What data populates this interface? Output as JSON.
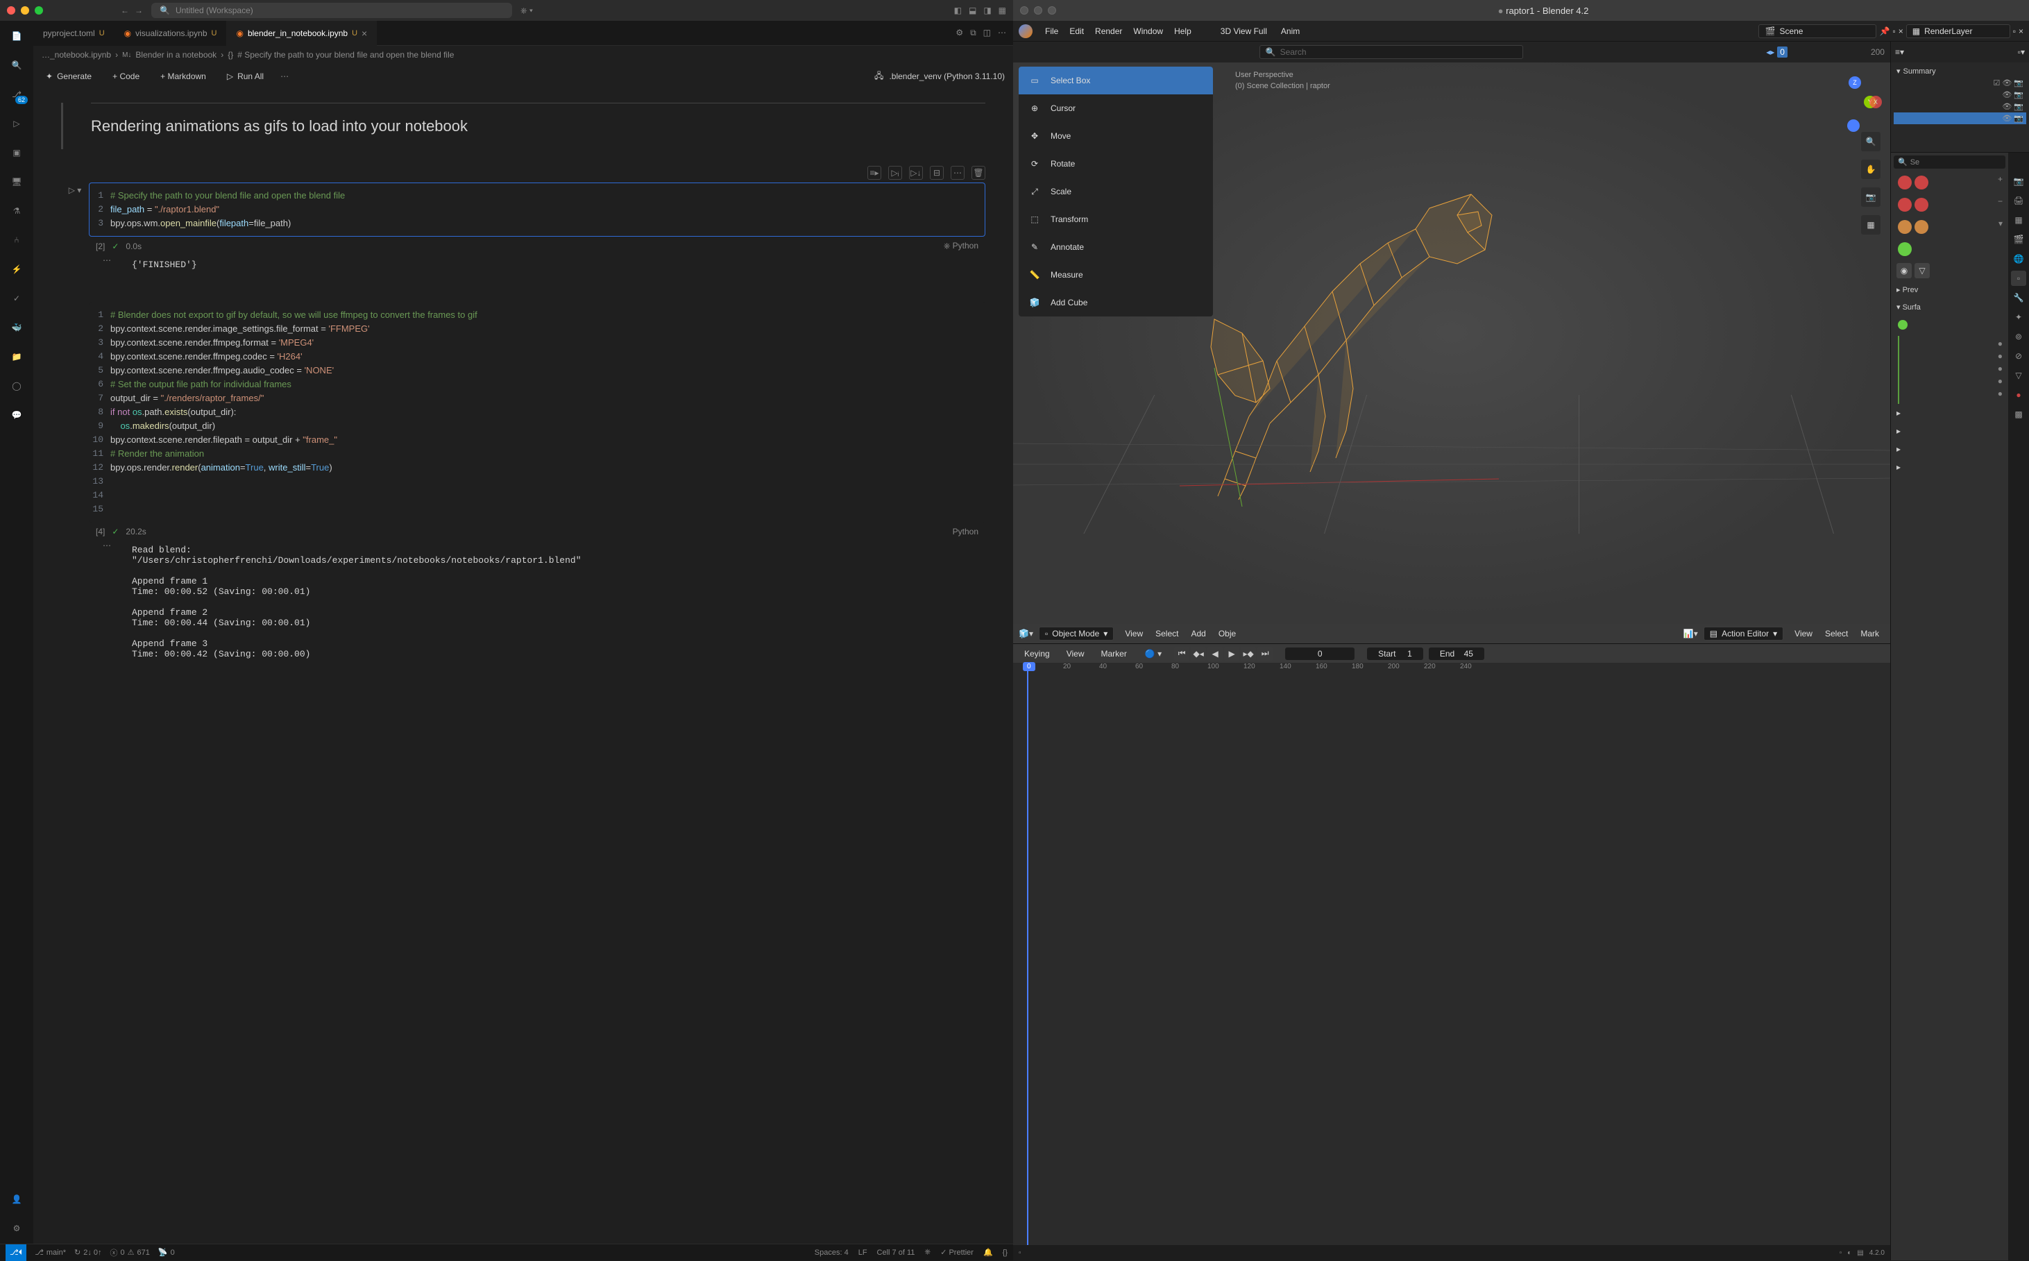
{
  "vscode": {
    "title": "Untitled (Workspace)",
    "traffic": {
      "red": "#ff5f56",
      "yellow": "#ffbd2e",
      "green": "#27c93f"
    },
    "activity_badge": "62",
    "tabs": [
      {
        "name": "pyproject.toml",
        "mod": "U"
      },
      {
        "name": "visualizations.ipynb",
        "mod": "U"
      },
      {
        "name": "blender_in_notebook.ipynb",
        "mod": "U",
        "active": true
      }
    ],
    "breadcrumb": {
      "file": "…_notebook.ipynb",
      "section_prefix": "M↓",
      "section": "Blender in a notebook",
      "cell": "# Specify the path to your blend file and open the blend file"
    },
    "toolbar": {
      "generate": "Generate",
      "code": "+ Code",
      "markdown": "+ Markdown",
      "run_all": "Run All",
      "kernel": ".blender_venv (Python 3.11.10)"
    },
    "md_heading": "Rendering animations as gifs to load into your notebook",
    "cell1": {
      "exec": "[2]",
      "time": "0.0s",
      "lang": "Python",
      "lines": {
        "l1_comment": "# Specify the path to your blend file and open the blend file",
        "l2_var": "file_path",
        "l2_eq": " = ",
        "l2_str": "\"./raptor1.blend\"",
        "l3_a": "bpy",
        "l3_b": ".ops.wm.",
        "l3_fn": "open_mainfile",
        "l3_c": "(",
        "l3_arg": "filepath",
        "l3_d": "=",
        "l3_arg2": "file_path",
        "l3_e": ")"
      },
      "output": "{'FINISHED'}"
    },
    "cell2": {
      "exec": "[4]",
      "time": "20.2s",
      "lang": "Python",
      "src": [
        {
          "n": "1",
          "html": "<span class='tok-comment'># Blender does not export to gif by default, so we will use ffmpeg to convert the frames to gif</span>"
        },
        {
          "n": "2",
          "html": "bpy.context.scene.render.image_settings.file_format = <span class='tok-str'>'FFMPEG'</span>"
        },
        {
          "n": "3",
          "html": "bpy.context.scene.render.ffmpeg.format = <span class='tok-str'>'MPEG4'</span>"
        },
        {
          "n": "4",
          "html": "bpy.context.scene.render.ffmpeg.codec = <span class='tok-str'>'H264'</span>"
        },
        {
          "n": "5",
          "html": "bpy.context.scene.render.ffmpeg.audio_codec = <span class='tok-str'>'NONE'</span>"
        },
        {
          "n": "6",
          "html": ""
        },
        {
          "n": "7",
          "html": "<span class='tok-comment'># Set the output file path for individual frames</span>"
        },
        {
          "n": "8",
          "html": "output_dir = <span class='tok-str'>\"./renders/raptor_frames/\"</span>"
        },
        {
          "n": "9",
          "html": "<span class='tok-key'>if</span> <span class='tok-key'>not</span> <span class='tok-obj'>os</span>.path.<span class='tok-func'>exists</span>(output_dir):"
        },
        {
          "n": "10",
          "html": "    <span class='tok-obj'>os</span>.<span class='tok-func'>makedirs</span>(output_dir)"
        },
        {
          "n": "11",
          "html": ""
        },
        {
          "n": "12",
          "html": "bpy.context.scene.render.filepath = output_dir + <span class='tok-str'>\"frame_\"</span>"
        },
        {
          "n": "13",
          "html": ""
        },
        {
          "n": "14",
          "html": "<span class='tok-comment'># Render the animation</span>"
        },
        {
          "n": "15",
          "html": "bpy.ops.render.<span class='tok-func'>render</span>(<span class='tok-var'>animation</span>=<span class='tok-bool'>True</span>, <span class='tok-var'>write_still</span>=<span class='tok-bool'>True</span>)"
        }
      ],
      "output": "Read blend:\n\"/Users/christopherfrenchi/Downloads/experiments/notebooks/notebooks/raptor1.blend\"\n\nAppend frame 1\nTime: 00:00.52 (Saving: 00:00.01)\n\nAppend frame 2\nTime: 00:00.44 (Saving: 00:00.01)\n\nAppend frame 3\nTime: 00:00.42 (Saving: 00:00.00)"
    },
    "status": {
      "branch": "main*",
      "sync": "2↓ 0↑",
      "errors": "0",
      "warnings": "671",
      "ports": "0",
      "spaces": "Spaces: 4",
      "eol": "LF",
      "cell": "Cell 7 of 11",
      "prettier": "Prettier"
    }
  },
  "blender": {
    "title": "raptor1 - Blender 4.2",
    "menus": [
      "File",
      "Edit",
      "Render",
      "Window",
      "Help"
    ],
    "workspaces": [
      "3D View Full",
      "Anim"
    ],
    "scene": "Scene",
    "layer": "RenderLayer",
    "search_ph": "Search",
    "ruler_end": "200",
    "viewport_info": {
      "l1": "User Perspective",
      "l2": "(0)  Scene Collection | raptor"
    },
    "tools": [
      "Select Box",
      "Cursor",
      "Move",
      "Rotate",
      "Scale",
      "Transform",
      "Annotate",
      "Measure",
      "Add Cube"
    ],
    "outliner": {
      "summary": "Summary"
    },
    "props": {
      "preview": "Prev",
      "surface": "Surfa"
    },
    "timeline": {
      "mode": "Object Mode",
      "menus": [
        "View",
        "Select",
        "Add",
        "Obje"
      ],
      "dope_mode": "Action Editor",
      "dope_menus": [
        "View",
        "Select",
        "Mark"
      ],
      "keying": "Keying",
      "view": "View",
      "marker": "Marker",
      "frame": "0",
      "start_lbl": "Start",
      "start_val": "1",
      "end_lbl": "End",
      "end_val": "45",
      "ticks": [
        "0",
        "20",
        "40",
        "60",
        "80",
        "100",
        "120",
        "140",
        "160",
        "180",
        "200",
        "220",
        "240"
      ]
    },
    "version": "4.2.0"
  }
}
